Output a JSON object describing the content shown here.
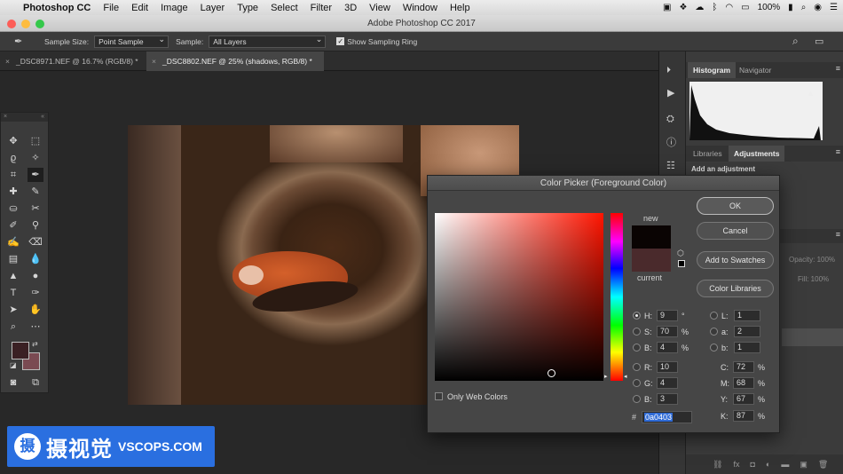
{
  "menubar": {
    "app": "Photoshop CC",
    "items": [
      "File",
      "Edit",
      "Image",
      "Layer",
      "Type",
      "Select",
      "Filter",
      "3D",
      "View",
      "Window",
      "Help"
    ],
    "battery": "100%"
  },
  "window": {
    "title": "Adobe Photoshop CC 2017"
  },
  "options": {
    "sample_size_label": "Sample Size:",
    "sample_size_value": "Point Sample",
    "sample_label": "Sample:",
    "sample_value": "All Layers",
    "sampling_ring": "Show Sampling Ring"
  },
  "tabs": [
    {
      "label": "_DSC8971.NEF @ 16.7% (RGB/8) *"
    },
    {
      "label": "_DSC8802.NEF @ 25% (shadows, RGB/8) *"
    }
  ],
  "panels": {
    "histogram_tab": "Histogram",
    "navigator_tab": "Navigator",
    "libraries_tab": "Libraries",
    "adjustments_tab": "Adjustments",
    "add_adjustment": "Add an adjustment",
    "opacity": "Opacity: 100%",
    "fill": "Fill: 100%"
  },
  "dialog": {
    "title": "Color Picker (Foreground Color)",
    "new_label": "new",
    "current_label": "current",
    "ok": "OK",
    "cancel": "Cancel",
    "add_swatches": "Add to Swatches",
    "color_libraries": "Color Libraries",
    "only_web_colors": "Only Web Colors",
    "H": "9",
    "H_unit": "°",
    "S": "70",
    "S_unit": "%",
    "B": "4",
    "B_unit": "%",
    "R": "10",
    "G": "4",
    "Bb": "3",
    "L": "1",
    "a": "2",
    "b": "1",
    "C": "72",
    "M": "68",
    "Y": "67",
    "K": "87",
    "pct": "%",
    "hex_label": "#",
    "hex": "0a0403",
    "new_color": "#0a0403",
    "current_color": "#4a2a2c"
  },
  "swatches": {
    "foreground": "#3a2024",
    "background": "#7a4a52"
  },
  "watermark": {
    "cn": "摄视觉",
    "en": "VSCOPS.COM",
    "logo": "摄"
  }
}
